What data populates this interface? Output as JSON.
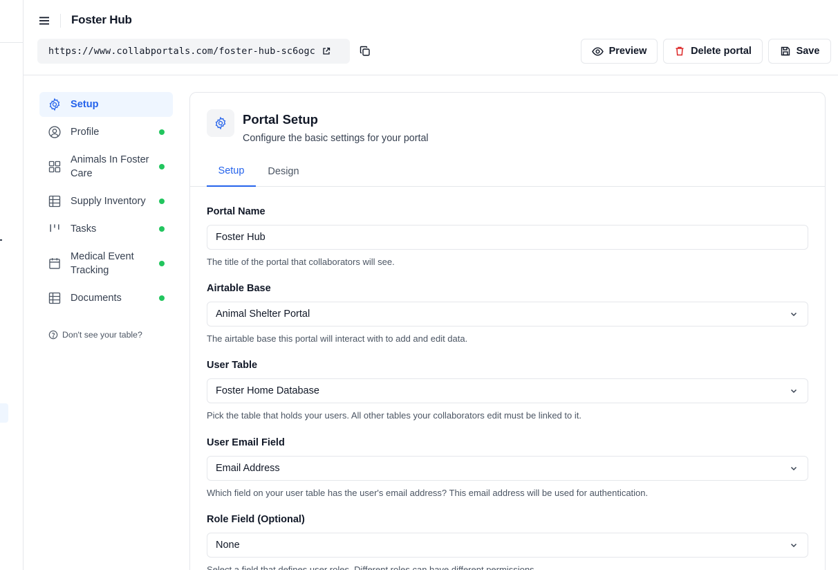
{
  "app": {
    "title": "Foster Hub"
  },
  "url": {
    "value": "https://www.collabportals.com/foster-hub-sc6ogc"
  },
  "actions": {
    "preview": "Preview",
    "delete": "Delete portal",
    "save": "Save"
  },
  "colors": {
    "accent": "#2563eb",
    "active_bg": "#eff6ff",
    "status_dot": "#22c55e",
    "danger": "#dc2626"
  },
  "sidebar": {
    "items": [
      {
        "label": "Setup",
        "icon": "gear-icon",
        "active": true,
        "dot": false
      },
      {
        "label": "Profile",
        "icon": "user-circle-icon",
        "active": false,
        "dot": true
      },
      {
        "label": "Animals In Foster Care",
        "icon": "grid-icon",
        "active": false,
        "dot": true
      },
      {
        "label": "Supply Inventory",
        "icon": "table-icon",
        "active": false,
        "dot": true
      },
      {
        "label": "Tasks",
        "icon": "kanban-icon",
        "active": false,
        "dot": true
      },
      {
        "label": "Medical Event Tracking",
        "icon": "calendar-icon",
        "active": false,
        "dot": true
      },
      {
        "label": "Documents",
        "icon": "table-icon",
        "active": false,
        "dot": true
      }
    ],
    "help": "Don't see your table?"
  },
  "main": {
    "title": "Portal Setup",
    "subtitle": "Configure the basic settings for your portal",
    "tabs": [
      {
        "label": "Setup",
        "active": true
      },
      {
        "label": "Design",
        "active": false
      }
    ],
    "fields": {
      "portal_name": {
        "label": "Portal Name",
        "value": "Foster Hub",
        "help": "The title of the portal that collaborators will see."
      },
      "airtable_base": {
        "label": "Airtable Base",
        "value": "Animal Shelter Portal",
        "help": "The airtable base this portal will interact with to add and edit data."
      },
      "user_table": {
        "label": "User Table",
        "value": "Foster Home Database",
        "help": "Pick the table that holds your users. All other tables your collaborators edit must be linked to it."
      },
      "user_email_field": {
        "label": "User Email Field",
        "value": "Email Address",
        "help": "Which field on your user table has the user's email address? This email address will be used for authentication."
      },
      "role_field": {
        "label": "Role Field (Optional)",
        "value": "None",
        "help": "Select a field that defines user roles. Different roles can have different permissions."
      }
    }
  }
}
